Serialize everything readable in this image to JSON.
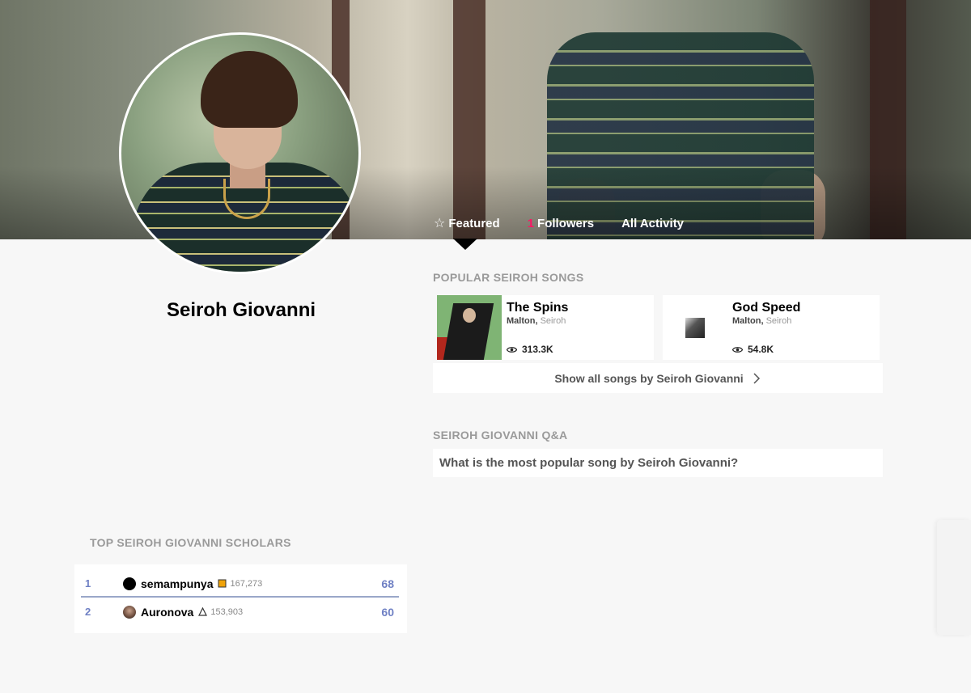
{
  "tabs": {
    "featured_label": "Featured",
    "followers_count": "1",
    "followers_label": "Followers",
    "activity_label": "All Activity"
  },
  "artist": {
    "name": "Seiroh Giovanni"
  },
  "songs_section": {
    "title": "POPULAR SEIROH SONGS",
    "songs": [
      {
        "title": "The Spins",
        "primary_artist": "Malton,",
        "featured_artist": "Seiroh",
        "views": "313.3K"
      },
      {
        "title": "God Speed",
        "primary_artist": "Malton,",
        "featured_artist": "Seiroh",
        "views": "54.8K"
      }
    ],
    "show_all_label": "Show all songs by Seiroh Giovanni"
  },
  "qa_section": {
    "title": "SEIROH GIOVANNI Q&A",
    "question": "What is the most popular song by Seiroh Giovanni?"
  },
  "scholars_section": {
    "title": "TOP SEIROH GIOVANNI SCHOLARS",
    "rows": [
      {
        "rank": "1",
        "name": "semampunya",
        "badge_color": "#f0a30a",
        "iq": "167,273",
        "score": "68"
      },
      {
        "rank": "2",
        "name": "Auronova",
        "badge_color": "#333333",
        "iq": "153,903",
        "score": "60"
      }
    ]
  },
  "colors": {
    "accent": "#ff1464",
    "scholar_blue": "#6f80c4"
  }
}
